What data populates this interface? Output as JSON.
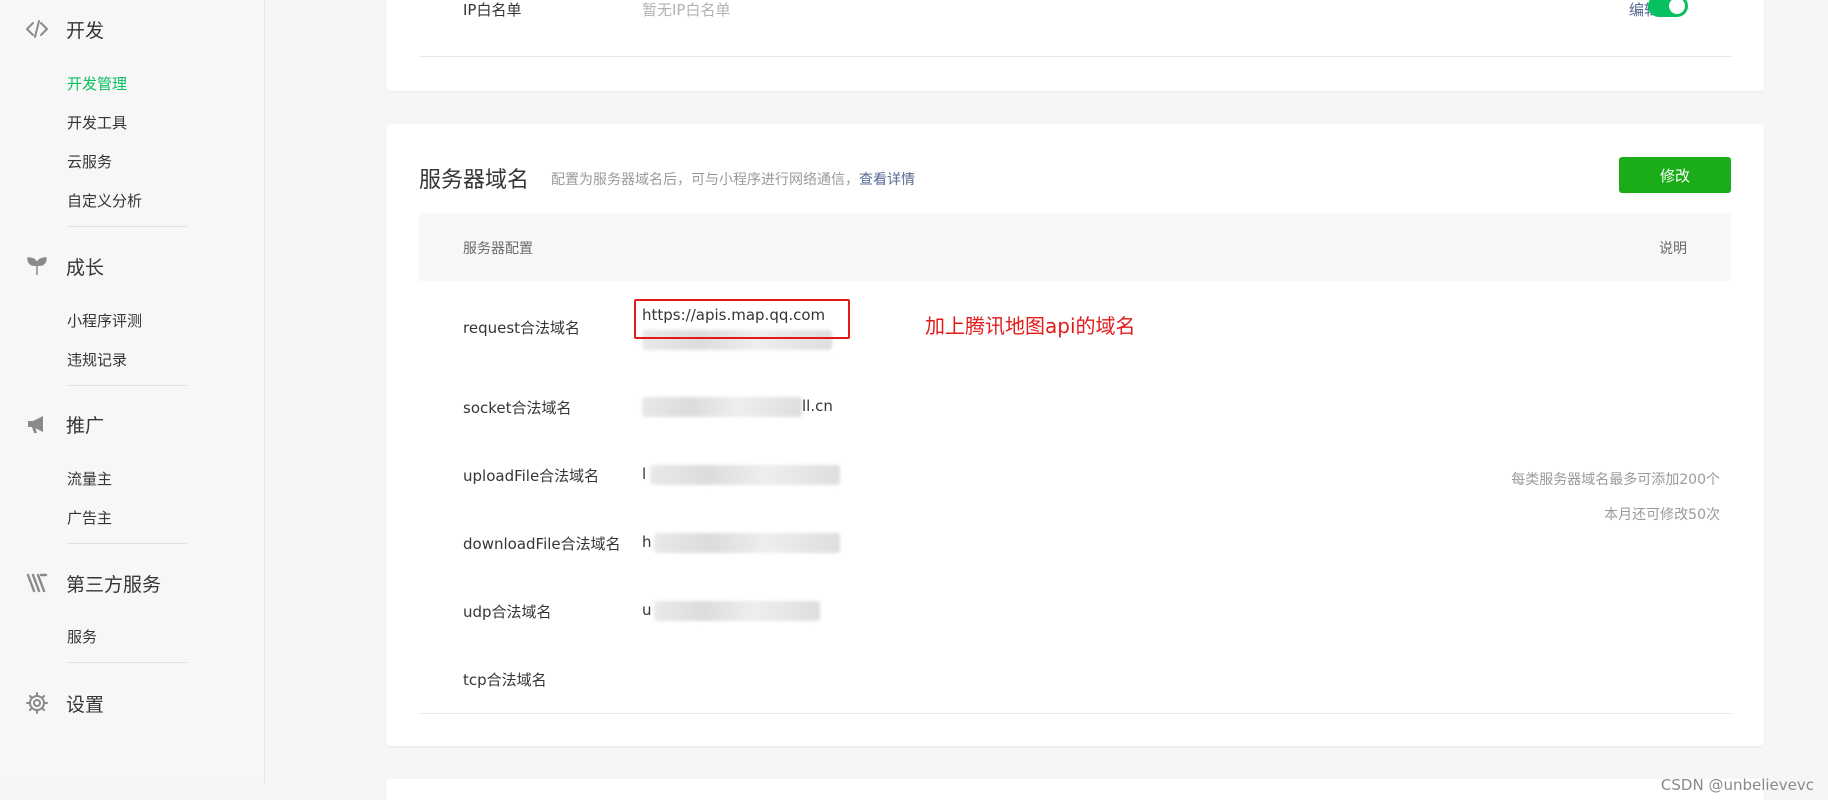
{
  "sidebar": {
    "sections": [
      {
        "title": "开发",
        "icon": "code-icon",
        "items": [
          "开发管理",
          "开发工具",
          "云服务",
          "自定义分析"
        ]
      },
      {
        "title": "成长",
        "icon": "sprout-icon",
        "items": [
          "小程序评测",
          "违规记录"
        ]
      },
      {
        "title": "推广",
        "icon": "megaphone-icon",
        "items": [
          "流量主",
          "广告主"
        ]
      },
      {
        "title": "第三方服务",
        "icon": "third-party-icon",
        "items": [
          "服务"
        ]
      },
      {
        "title": "设置",
        "icon": "gear-icon",
        "items": []
      }
    ],
    "active_item": "开发管理"
  },
  "ip_whitelist": {
    "label": "IP白名单",
    "value": "暂无IP白名单",
    "edit_label": "编辑",
    "toggle_on": true
  },
  "server_domain": {
    "title": "服务器域名",
    "description": "配置为服务器域名后，可与小程序进行网络通信，",
    "link_text": "查看详情",
    "modify_label": "修改",
    "header_config": "服务器配置",
    "header_note": "说明",
    "rows": [
      {
        "label": "request合法域名",
        "value": "https://apis.map.qq.com"
      },
      {
        "label": "socket合法域名",
        "value": "ll.cn"
      },
      {
        "label": "uploadFile合法域名",
        "value": "l"
      },
      {
        "label": "downloadFile合法域名",
        "value": "h"
      },
      {
        "label": "udp合法域名",
        "value": "u"
      },
      {
        "label": "tcp合法域名",
        "value": ""
      }
    ],
    "note_line1": "每类服务器域名最多可添加200个",
    "note_line2": "本月还可修改50次",
    "annotation": "加上腾讯地图api的域名"
  },
  "watermark": "CSDN @unbelievevc",
  "colors": {
    "accent_green": "#07c160",
    "button_green": "#1aad19",
    "link_blue": "#576b95",
    "annotation_red": "#e31a1a"
  }
}
